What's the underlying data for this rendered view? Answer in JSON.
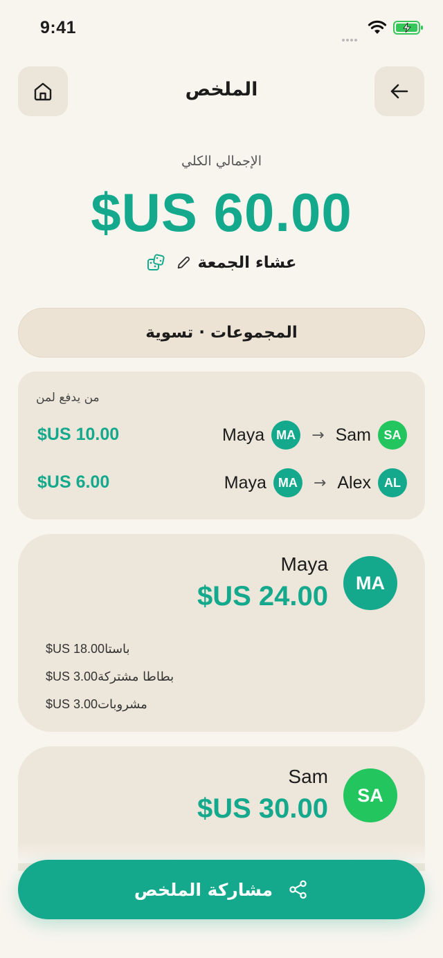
{
  "status_bar": {
    "time": "9:41"
  },
  "header": {
    "title": "الملخص",
    "home_icon": "home-icon",
    "back_icon": "arrow-left-icon"
  },
  "total": {
    "label": "الإجمالي الكلي",
    "amount": "$US 60.00"
  },
  "event": {
    "name": "عشاء الجمعة",
    "edit_icon": "pencil-icon",
    "dice_icon": "dice-icon"
  },
  "groups_bar": {
    "label": "المجموعات · تسوية"
  },
  "settlement": {
    "title": "من يدفع لمن",
    "rows": [
      {
        "from_name": "Sam",
        "from_initials": "SA",
        "to_name": "Maya",
        "to_initials": "MA",
        "amount": "$US 10.00"
      },
      {
        "from_name": "Alex",
        "from_initials": "AL",
        "to_name": "Maya",
        "to_initials": "MA",
        "amount": "$US 6.00"
      }
    ]
  },
  "people": [
    {
      "name": "Maya",
      "initials": "MA",
      "amount": "$US 24.00",
      "avatar_color": "#14a98c",
      "items": [
        {
          "label": "باستا",
          "price": "$US 18.00"
        },
        {
          "label": "بطاطا مشتركة",
          "price": "$US 3.00"
        },
        {
          "label": "مشروبات",
          "price": "$US 3.00"
        }
      ]
    },
    {
      "name": "Sam",
      "initials": "SA",
      "amount": "$US 30.00",
      "avatar_color": "#22c55e"
    }
  ],
  "share_button": {
    "label": "مشاركة الملخص",
    "icon": "share-icon"
  },
  "colors": {
    "accent": "#14a98c",
    "green": "#22c55e",
    "background": "#f8f5ef",
    "card": "#ede6da"
  }
}
